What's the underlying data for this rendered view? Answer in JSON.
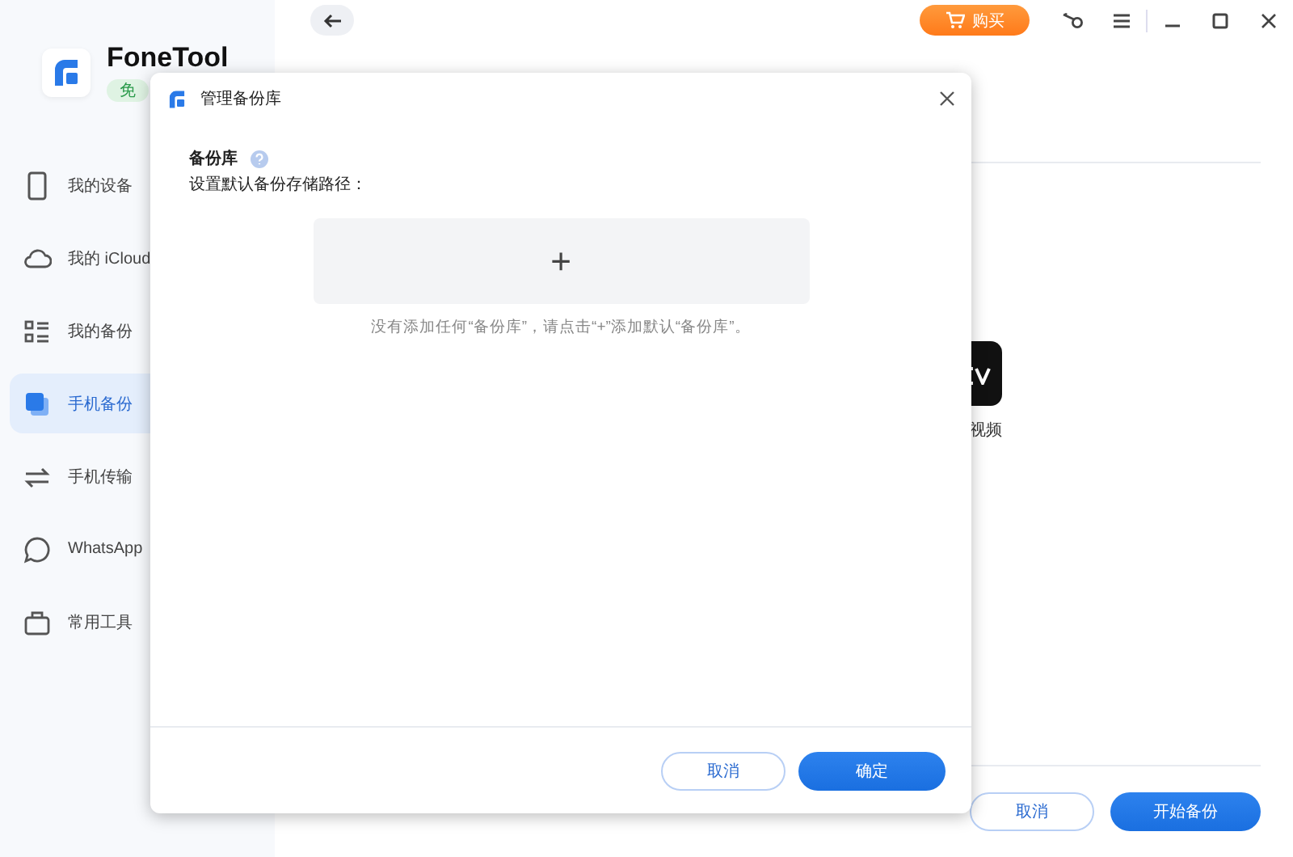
{
  "app": {
    "name": "FoneTool",
    "badge": "免"
  },
  "sidebar": {
    "items": [
      {
        "label": "我的设备",
        "selected": false
      },
      {
        "label": "我的 iCloud",
        "selected": false
      },
      {
        "label": "我的备份",
        "selected": false
      },
      {
        "label": "手机备份",
        "selected": true
      },
      {
        "label": "手机传输",
        "selected": false
      },
      {
        "label": "WhatsApp",
        "selected": false
      },
      {
        "label": "常用工具",
        "selected": false
      }
    ]
  },
  "topbar": {
    "buy_button": "购买"
  },
  "page": {
    "item_label": "视频",
    "buttons": [
      "取消",
      "开始备份"
    ]
  },
  "dialog": {
    "title": "管理备份库",
    "section": "备份库",
    "subtitle": "设置默认备份存储路径：",
    "add_button": "+",
    "empty_hint": "没有添加任何“备份库”，请点击“+”添加默认“备份库”。",
    "buttons": [
      {
        "label": "取消",
        "kind": "secondary"
      },
      {
        "label": "确定",
        "kind": "primary"
      }
    ]
  }
}
